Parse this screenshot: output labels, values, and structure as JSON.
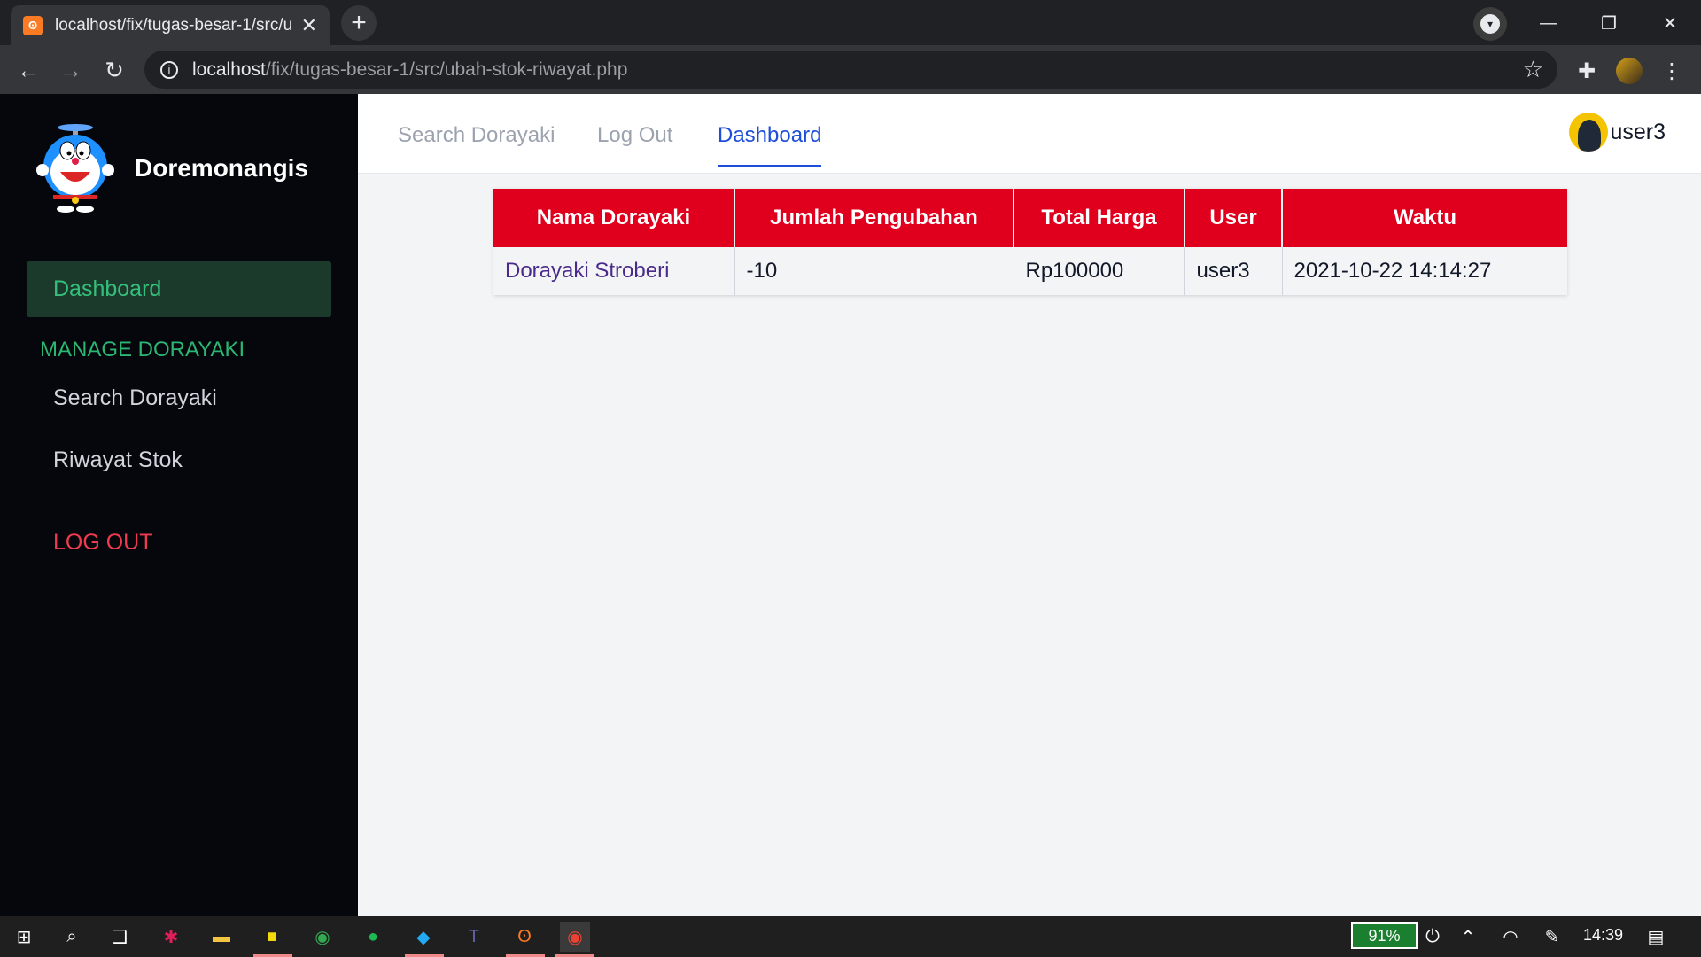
{
  "browser": {
    "tab_title": "localhost/fix/tugas-besar-1/src/u",
    "url_host": "localhost",
    "url_path": "/fix/tugas-besar-1/src/ubah-stok-riwayat.php"
  },
  "sidebar": {
    "brand": "Doremonangis",
    "active_item": "Dashboard",
    "section_title": "MANAGE DORAYAKI",
    "items": [
      {
        "label": "Search Dorayaki"
      },
      {
        "label": "Riwayat Stok"
      }
    ],
    "logout_label": "LOG OUT"
  },
  "topnav": {
    "links": [
      {
        "label": "Search Dorayaki"
      },
      {
        "label": "Log Out"
      },
      {
        "label": "Dashboard"
      }
    ],
    "username": "user3"
  },
  "table": {
    "headers": [
      "Nama Dorayaki",
      "Jumlah Pengubahan",
      "Total Harga",
      "User",
      "Waktu"
    ],
    "rows": [
      [
        "Dorayaki Stroberi",
        "-10",
        "Rp100000",
        "user3",
        "2021-10-22 14:14:27"
      ]
    ]
  },
  "taskbar": {
    "battery": "91%",
    "clock": "14:39"
  },
  "colors": {
    "accent_red": "#e0001e",
    "accent_green": "#2bb673",
    "active_blue": "#1d4ed8"
  }
}
